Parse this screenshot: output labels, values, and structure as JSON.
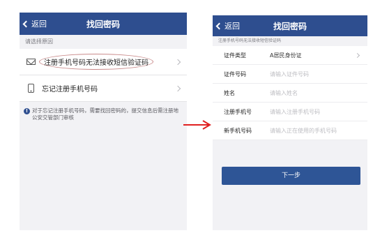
{
  "left_screen": {
    "nav": {
      "back_label": "返回",
      "title": "找回密码"
    },
    "section_hint": "请选择原因",
    "options": [
      {
        "label": "注册手机号码无法接收短信验证码",
        "icon": "mail-icon",
        "highlighted": true
      },
      {
        "label": "忘记注册手机号码",
        "icon": "phone-icon",
        "highlighted": false
      }
    ],
    "notice": "对于忘记注册手机号码，需要找回密码的，提交信息后需注册地公安交管部门审核"
  },
  "right_screen": {
    "nav": {
      "back_label": "返回",
      "title": "找回密码"
    },
    "section_hint": "注册手机号码无法接收短信验证码",
    "fields": [
      {
        "label": "证件类型",
        "value": "A居民身份证",
        "placeholder": "",
        "has_arrow": true
      },
      {
        "label": "证件号码",
        "value": "",
        "placeholder": "请输入证件号码",
        "has_arrow": false
      },
      {
        "label": "姓名",
        "value": "",
        "placeholder": "请输入姓名",
        "has_arrow": false
      },
      {
        "label": "注册手机号",
        "value": "",
        "placeholder": "请输入注册手机号码",
        "has_arrow": false
      },
      {
        "label": "新手机号码",
        "value": "",
        "placeholder": "请输入正在使用的手机号码",
        "has_arrow": false
      }
    ],
    "next_button": "下一步"
  },
  "colors": {
    "nav_bg": "#2e4e8f",
    "button_bg": "#2e5596",
    "arrow_red": "#e02020",
    "highlight_ring": "#c98a8a"
  }
}
